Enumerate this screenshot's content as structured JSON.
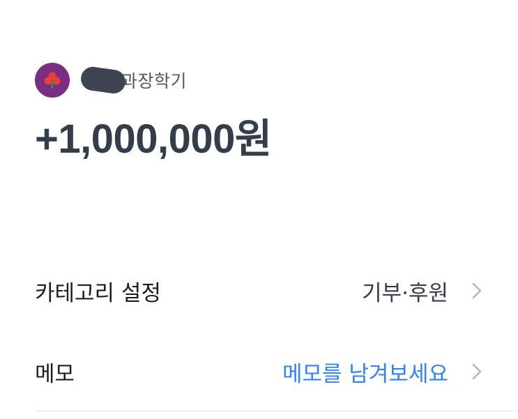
{
  "sender": {
    "avatar_icon": "flower-logo-icon",
    "avatar_color": "#7b2d82",
    "name_visible": "과장학기"
  },
  "transaction": {
    "amount": "+1,000,000원"
  },
  "category": {
    "label": "카테고리 설정",
    "value": "기부·후원",
    "chevron_icon": "chevron-right-icon"
  },
  "memo": {
    "label": "메모",
    "placeholder": "메모를 남겨보세요",
    "placeholder_color": "#3182f6",
    "chevron_icon": "chevron-right-icon"
  }
}
